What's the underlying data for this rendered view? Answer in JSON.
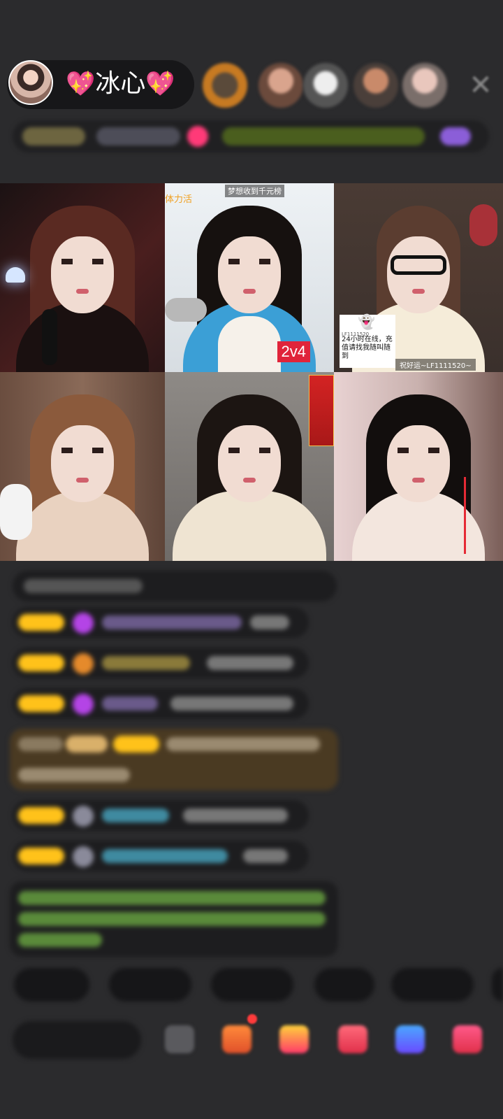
{
  "header": {
    "host_name": "冰心",
    "host_heart_left": "💖",
    "host_heart_right": "💖",
    "close_icon": "close-icon"
  },
  "video_grid": {
    "cells": [
      {
        "id": "streamer-1",
        "overlay": ""
      },
      {
        "id": "streamer-2",
        "overlay_left": "体力活",
        "overlay_top": "梦想收到千元榜",
        "vs_badge": "2v4"
      },
      {
        "id": "streamer-3",
        "note_card_line1": "24小时在线，充",
        "note_card_line2": "值请找我随叫随",
        "note_card_line3": "到",
        "note_card_id": "LF1111520",
        "id_strip": "祝好运~LF1111520~"
      },
      {
        "id": "streamer-4",
        "overlay": ""
      },
      {
        "id": "streamer-5",
        "overlay": ""
      },
      {
        "id": "streamer-6",
        "overlay": ""
      }
    ]
  },
  "colors": {
    "background": "#2b2b2d",
    "accent_pink": "#ff4fa8",
    "badge_yellow": "#ffc21a",
    "vs_red": "#e0243a"
  }
}
